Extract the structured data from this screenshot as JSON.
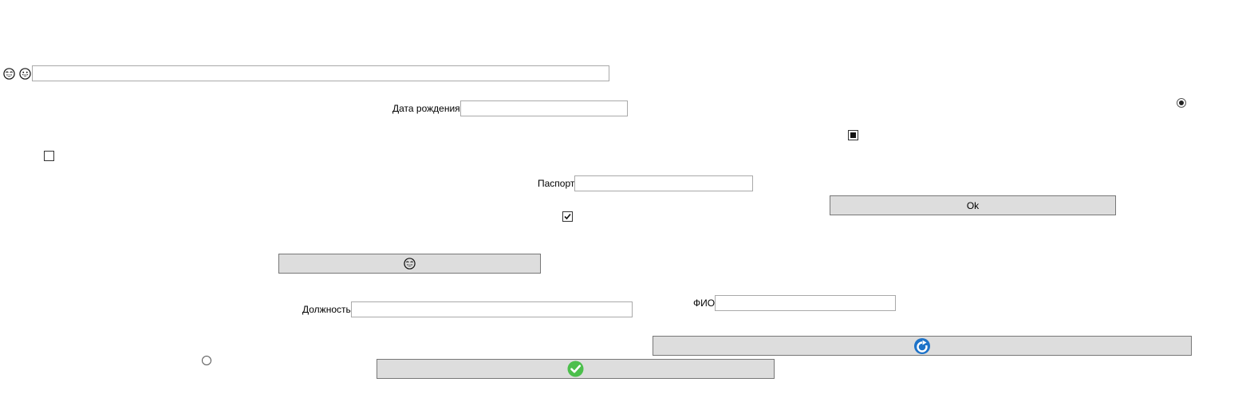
{
  "top_row": {
    "icon_left": "crying-laughing-face-icon",
    "icon_right": "grinning-face-icon",
    "text_value": ""
  },
  "birth_date": {
    "label": "Дата рождения",
    "value": ""
  },
  "passport": {
    "label": "Паспорт",
    "value": ""
  },
  "position": {
    "label": "Должность",
    "value": ""
  },
  "full_name": {
    "label": "ФИО",
    "value": ""
  },
  "ok_button": {
    "label": "Ok"
  },
  "emoji_button": {
    "icon": "crying-laughing-face-icon"
  },
  "refresh_button": {
    "icon": "refresh-icon",
    "icon_color": "#1e73c8"
  },
  "confirm_button": {
    "icon": "checkmark-icon",
    "icon_color": "#4cbf4c"
  },
  "checkboxes": {
    "left_unchecked": {
      "checked": false
    },
    "middle_checked": {
      "checked": true
    },
    "right_indeterminate": {
      "state": "indeterminate"
    }
  },
  "radios": {
    "top_right": {
      "selected": true
    },
    "bottom_left": {
      "selected": false
    }
  },
  "colors": {
    "button_face": "#dddddd",
    "button_border": "#777777",
    "input_border": "#a9a9a9"
  }
}
